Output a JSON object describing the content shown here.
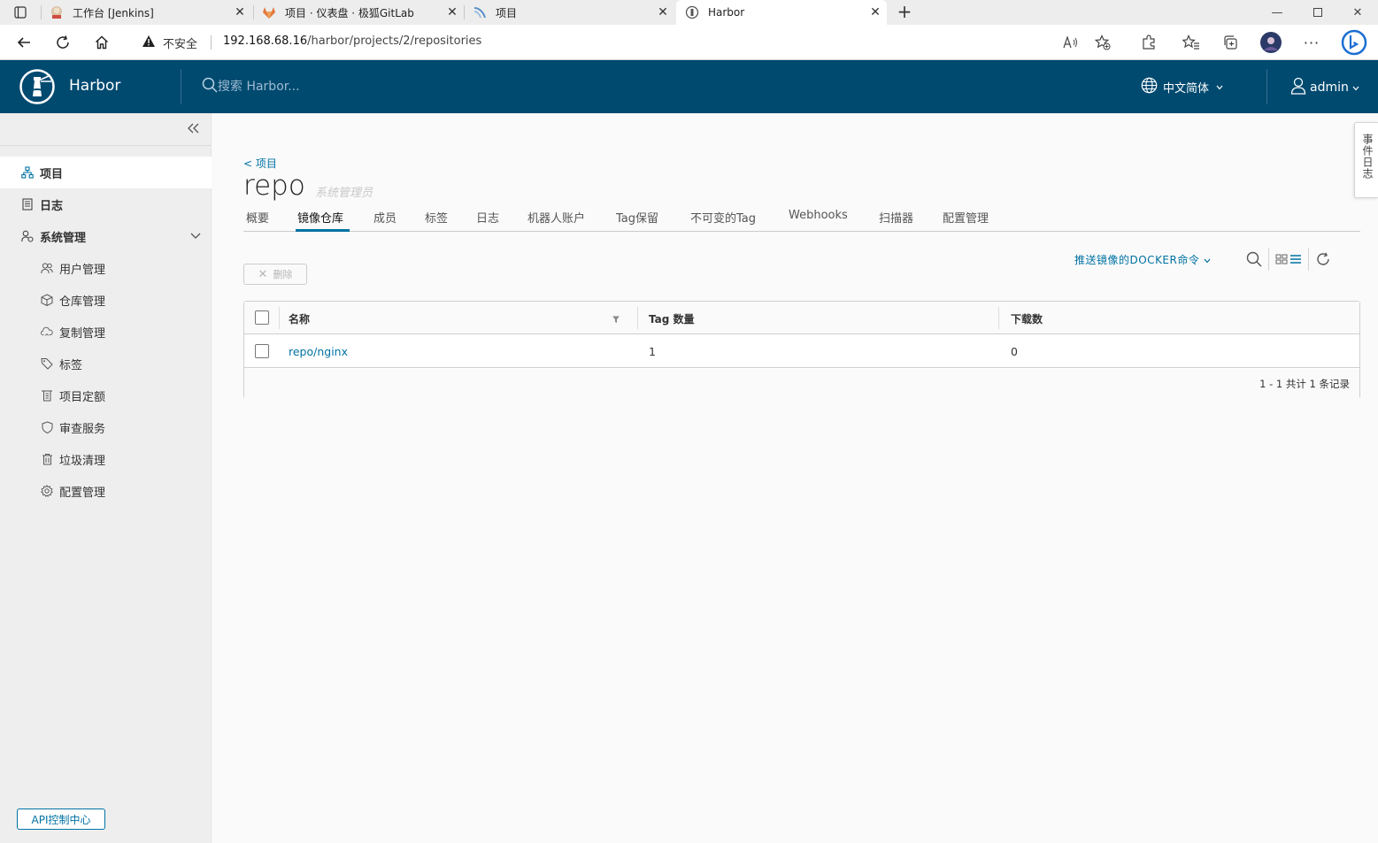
{
  "browser": {
    "tabs": [
      {
        "title": "工作台 [Jenkins]"
      },
      {
        "title": "项目 · 仪表盘 · 极狐GitLab"
      },
      {
        "title": "项目"
      },
      {
        "title": "Harbor"
      }
    ],
    "security_label": "不安全",
    "url_host": "192.168.68.16",
    "url_path": "/harbor/projects/2/repositories"
  },
  "header": {
    "brand": "Harbor",
    "search_placeholder": "搜索 Harbor...",
    "language": "中文简体",
    "user": "admin"
  },
  "sidebar": {
    "items": [
      {
        "label": "项目"
      },
      {
        "label": "日志"
      },
      {
        "label": "系统管理"
      }
    ],
    "admin_items": [
      {
        "label": "用户管理"
      },
      {
        "label": "仓库管理"
      },
      {
        "label": "复制管理"
      },
      {
        "label": "标签"
      },
      {
        "label": "项目定额"
      },
      {
        "label": "审查服务"
      },
      {
        "label": "垃圾清理"
      },
      {
        "label": "配置管理"
      }
    ],
    "api_button": "API控制中心"
  },
  "project": {
    "back_link": "< 项目",
    "name": "repo",
    "role": "系统管理员",
    "tabs": [
      {
        "label": "概要"
      },
      {
        "label": "镜像仓库"
      },
      {
        "label": "成员"
      },
      {
        "label": "标签"
      },
      {
        "label": "日志"
      },
      {
        "label": "机器人账户"
      },
      {
        "label": "Tag保留"
      },
      {
        "label": "不可变的Tag"
      },
      {
        "label": "Webhooks"
      },
      {
        "label": "扫描器"
      },
      {
        "label": "配置管理"
      }
    ],
    "active_tab": "镜像仓库"
  },
  "repos": {
    "push_command": "推送镜像的DOCKER命令",
    "delete_button": "删除",
    "columns": {
      "name": "名称",
      "tags": "Tag 数量",
      "pulls": "下载数"
    },
    "rows": [
      {
        "name": "repo/nginx",
        "tags": "1",
        "pulls": "0"
      }
    ],
    "pagination": "1 - 1 共计 1 条记录"
  },
  "event_log": "事件日志",
  "colors": {
    "header_bg": "#004a70",
    "accent": "#0072a3",
    "sidebar_bg": "#eeeeee"
  }
}
